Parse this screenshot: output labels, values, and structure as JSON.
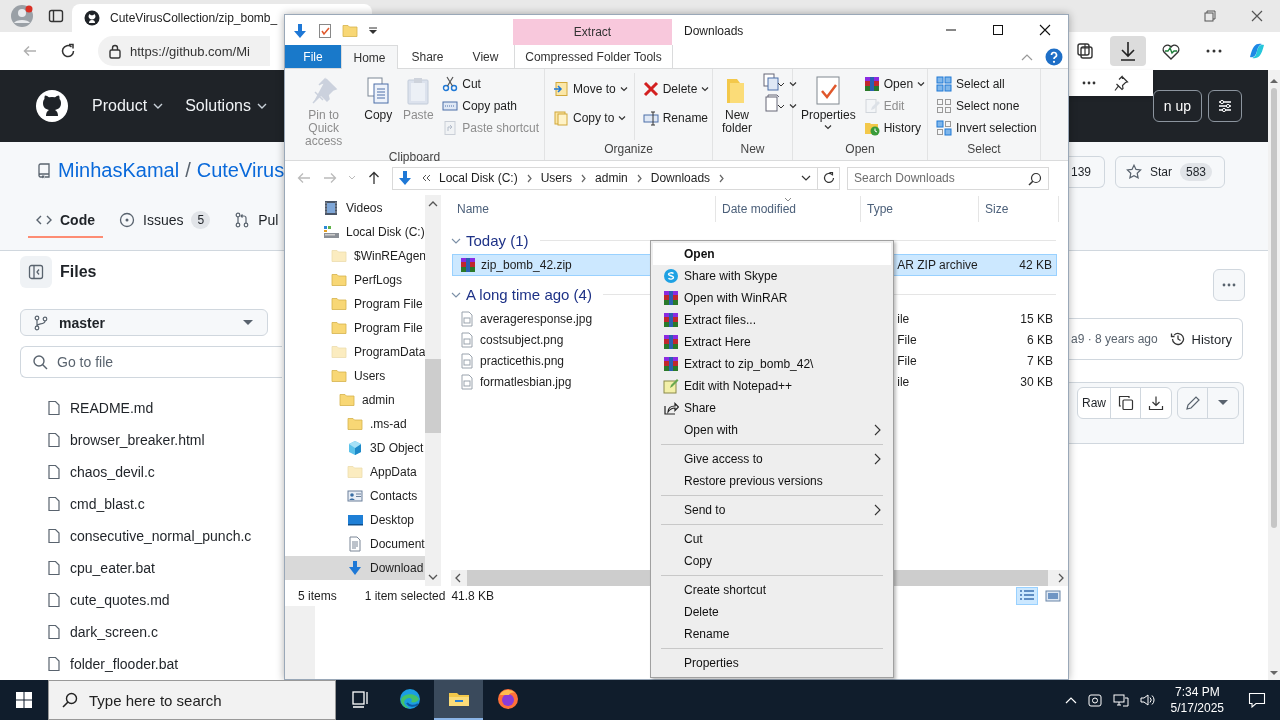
{
  "browser": {
    "tab_title": "CuteVirusCollection/zip_bomb_",
    "url": "https://github.com/Mi",
    "downloads_open": true
  },
  "github": {
    "nav": [
      {
        "label": "Product"
      },
      {
        "label": "Solutions"
      }
    ],
    "sign_up": "n up",
    "repo": {
      "owner": "MinhasKamal",
      "separator": "/",
      "name": "CuteVirus"
    },
    "tabs": [
      {
        "label": "Code",
        "selected": true
      },
      {
        "label": "Issues",
        "count": "5",
        "selected": false
      },
      {
        "label": "Pul",
        "selected": false
      }
    ],
    "files_title": "Files",
    "branch": "master",
    "file_search": {
      "placeholder": "Go to file"
    },
    "files": [
      "README.md",
      "browser_breaker.html",
      "chaos_devil.c",
      "cmd_blast.c",
      "consecutive_normal_punch.c",
      "cpu_eater.bat",
      "cute_quotes.md",
      "dark_screen.c",
      "folder_flooder.bat"
    ],
    "fork_count": "139",
    "star": {
      "label": "Star",
      "count": "583"
    },
    "commit": "a9 · 8 years ago",
    "history": "History",
    "raw": "Raw"
  },
  "explorer": {
    "title": "Downloads",
    "context_tab": "Extract",
    "tabs": [
      {
        "label": "File",
        "kind": "file",
        "selected": false
      },
      {
        "label": "Home",
        "kind": "tab",
        "selected": true
      },
      {
        "label": "Share",
        "kind": "tab",
        "selected": false
      },
      {
        "label": "View",
        "kind": "tab",
        "selected": false
      },
      {
        "label": "Compressed Folder Tools",
        "kind": "context",
        "selected": false
      }
    ],
    "ribbon": [
      {
        "label": "Clipboard",
        "columns": [
          [
            {
              "label": "Pin to Quick access",
              "kind": "large",
              "disabled": true,
              "dropdown": false
            }
          ],
          [
            {
              "label": "Copy",
              "kind": "large",
              "disabled": false,
              "dropdown": false
            }
          ],
          [
            {
              "label": "Paste",
              "kind": "large",
              "disabled": true,
              "dropdown": false
            }
          ],
          [
            {
              "label": "Cut",
              "kind": "small",
              "disabled": false,
              "dropdown": false
            },
            {
              "label": "Copy path",
              "kind": "small",
              "disabled": false,
              "dropdown": false
            },
            {
              "label": "Paste shortcut",
              "kind": "small",
              "disabled": true,
              "dropdown": false
            }
          ]
        ]
      },
      {
        "label": "Organize",
        "columns": [
          [
            {
              "label": "Move to",
              "kind": "small",
              "disabled": false,
              "dropdown": true
            },
            {
              "label": "Copy to",
              "kind": "small",
              "disabled": false,
              "dropdown": true
            }
          ],
          [
            {
              "label": "Delete",
              "kind": "small",
              "disabled": false,
              "dropdown": true
            },
            {
              "label": "Rename",
              "kind": "small",
              "disabled": false,
              "dropdown": false
            }
          ]
        ]
      },
      {
        "label": "New",
        "columns": [
          [
            {
              "label": "New folder",
              "kind": "large",
              "disabled": false,
              "dropdown": false
            }
          ],
          [
            {
              "kind": "small",
              "disabled": false,
              "dropdown": true
            },
            {
              "kind": "small",
              "disabled": false,
              "dropdown": true
            }
          ]
        ]
      },
      {
        "label": "Open",
        "columns": [
          [
            {
              "label": "Properties",
              "kind": "large",
              "disabled": false,
              "dropdown": true
            }
          ],
          [
            {
              "label": "Open",
              "kind": "small",
              "disabled": false,
              "dropdown": true
            },
            {
              "label": "Edit",
              "kind": "small",
              "disabled": true,
              "dropdown": false
            },
            {
              "label": "History",
              "kind": "small",
              "disabled": false,
              "dropdown": false
            }
          ]
        ]
      },
      {
        "label": "Select",
        "columns": [
          [
            {
              "label": "Select all",
              "kind": "small",
              "disabled": false,
              "dropdown": false
            },
            {
              "label": "Select none",
              "kind": "small",
              "disabled": false,
              "dropdown": false
            },
            {
              "label": "Invert selection",
              "kind": "small",
              "disabled": false,
              "dropdown": false
            }
          ]
        ]
      }
    ],
    "path": [
      "Local Disk (C:)",
      "Users",
      "admin",
      "Downloads"
    ],
    "search": {
      "placeholder": "Search Downloads"
    },
    "tree": [
      {
        "label": "Videos",
        "kind": "videos",
        "hidden": false,
        "selected": false
      },
      {
        "label": "Local Disk (C:)",
        "kind": "drive",
        "hidden": false,
        "selected": false,
        "children": [
          {
            "label": "$WinREAgen",
            "kind": "folder",
            "hidden": true,
            "selected": false
          },
          {
            "label": "PerfLogs",
            "kind": "folder",
            "hidden": false,
            "selected": false
          },
          {
            "label": "Program File",
            "kind": "folder",
            "hidden": false,
            "selected": false
          },
          {
            "label": "Program File",
            "kind": "folder",
            "hidden": false,
            "selected": false
          },
          {
            "label": "ProgramData",
            "kind": "folder",
            "hidden": true,
            "selected": false
          },
          {
            "label": "Users",
            "kind": "folder",
            "hidden": false,
            "selected": false,
            "children": [
              {
                "label": "admin",
                "kind": "folder",
                "hidden": false,
                "selected": false,
                "children": [
                  {
                    "label": ".ms-ad",
                    "kind": "folder",
                    "hidden": false,
                    "selected": false
                  },
                  {
                    "label": "3D Object",
                    "kind": "cube",
                    "hidden": false,
                    "selected": false
                  },
                  {
                    "label": "AppData",
                    "kind": "folder",
                    "hidden": true,
                    "selected": false
                  },
                  {
                    "label": "Contacts",
                    "kind": "contacts",
                    "hidden": false,
                    "selected": false
                  },
                  {
                    "label": "Desktop",
                    "kind": "desktop",
                    "hidden": false,
                    "selected": false
                  },
                  {
                    "label": "Document",
                    "kind": "documents",
                    "hidden": false,
                    "selected": false
                  },
                  {
                    "label": "Download",
                    "kind": "downloads",
                    "hidden": false,
                    "selected": true
                  }
                ]
              }
            ]
          }
        ]
      }
    ],
    "columns": [
      {
        "label": "Name",
        "sorted": false
      },
      {
        "label": "Date modified",
        "sorted": true
      },
      {
        "label": "Type",
        "sorted": false
      },
      {
        "label": "Size",
        "sorted": false
      }
    ],
    "groups": [
      {
        "label": "Today (1)",
        "expanded": true,
        "files": [
          {
            "name": "zip_bomb_42.zip",
            "kind": "archive",
            "type": "AR ZIP archive",
            "size": "42 KB",
            "selected": true
          }
        ]
      },
      {
        "label": "A long time ago (4)",
        "expanded": true,
        "files": [
          {
            "name": "averageresponse.jpg",
            "kind": "image",
            "type": "ile",
            "size": "15 KB",
            "selected": false
          },
          {
            "name": "costsubject.png",
            "kind": "image",
            "type": "File",
            "size": "6 KB",
            "selected": false
          },
          {
            "name": "practicethis.png",
            "kind": "image",
            "type": "File",
            "size": "7 KB",
            "selected": false
          },
          {
            "name": "formatlesbian.jpg",
            "kind": "image",
            "type": "ile",
            "size": "30 KB",
            "selected": false
          }
        ]
      }
    ],
    "status": {
      "count": "5 items",
      "selection": "1 item selected",
      "size": "41.8 KB"
    },
    "views": [
      {
        "kind": "details",
        "selected": true
      },
      {
        "kind": "thumbnails",
        "selected": false
      }
    ]
  },
  "context_menu": {
    "items": [
      {
        "label": "Open",
        "kind": "plain",
        "default": true,
        "submenu": false,
        "selected": true
      },
      {
        "label": "Share with Skype",
        "kind": "skype",
        "default": false,
        "submenu": false,
        "selected": false
      },
      {
        "label": "Open with WinRAR",
        "kind": "winrar",
        "default": false,
        "submenu": false,
        "selected": false
      },
      {
        "label": "Extract files...",
        "kind": "winrar",
        "default": false,
        "submenu": false,
        "selected": false
      },
      {
        "label": "Extract Here",
        "kind": "winrar",
        "default": false,
        "submenu": false,
        "selected": false
      },
      {
        "label": "Extract to zip_bomb_42\\",
        "kind": "winrar",
        "default": false,
        "submenu": false,
        "selected": false
      },
      {
        "label": "Edit with Notepad++",
        "kind": "notepad",
        "default": false,
        "submenu": false,
        "selected": false
      },
      {
        "label": "Share",
        "kind": "share",
        "default": false,
        "submenu": false,
        "selected": false
      },
      {
        "label": "Open with",
        "kind": "plain",
        "default": false,
        "submenu": true,
        "selected": false
      },
      {
        "kind": "separator"
      },
      {
        "label": "Give access to",
        "kind": "plain",
        "default": false,
        "submenu": true,
        "selected": false
      },
      {
        "label": "Restore previous versions",
        "kind": "plain",
        "default": false,
        "submenu": false,
        "selected": false
      },
      {
        "kind": "separator"
      },
      {
        "label": "Send to",
        "kind": "plain",
        "default": false,
        "submenu": true,
        "selected": false
      },
      {
        "kind": "separator"
      },
      {
        "label": "Cut",
        "kind": "plain",
        "default": false,
        "submenu": false,
        "selected": false
      },
      {
        "label": "Copy",
        "kind": "plain",
        "default": false,
        "submenu": false,
        "selected": false
      },
      {
        "kind": "separator"
      },
      {
        "label": "Create shortcut",
        "kind": "plain",
        "default": false,
        "submenu": false,
        "selected": false
      },
      {
        "label": "Delete",
        "kind": "plain",
        "default": false,
        "submenu": false,
        "selected": false
      },
      {
        "label": "Rename",
        "kind": "plain",
        "default": false,
        "submenu": false,
        "selected": false
      },
      {
        "kind": "separator"
      },
      {
        "label": "Properties",
        "kind": "plain",
        "default": false,
        "submenu": false,
        "selected": false
      }
    ]
  },
  "taskbar": {
    "search_placeholder": "Type here to search",
    "time": "7:34 PM",
    "date": "5/17/2025",
    "apps": [
      {
        "kind": "taskview",
        "active": false
      },
      {
        "kind": "edge",
        "active": false
      },
      {
        "kind": "explorer",
        "active": true
      },
      {
        "kind": "firefox",
        "active": false
      }
    ]
  }
}
